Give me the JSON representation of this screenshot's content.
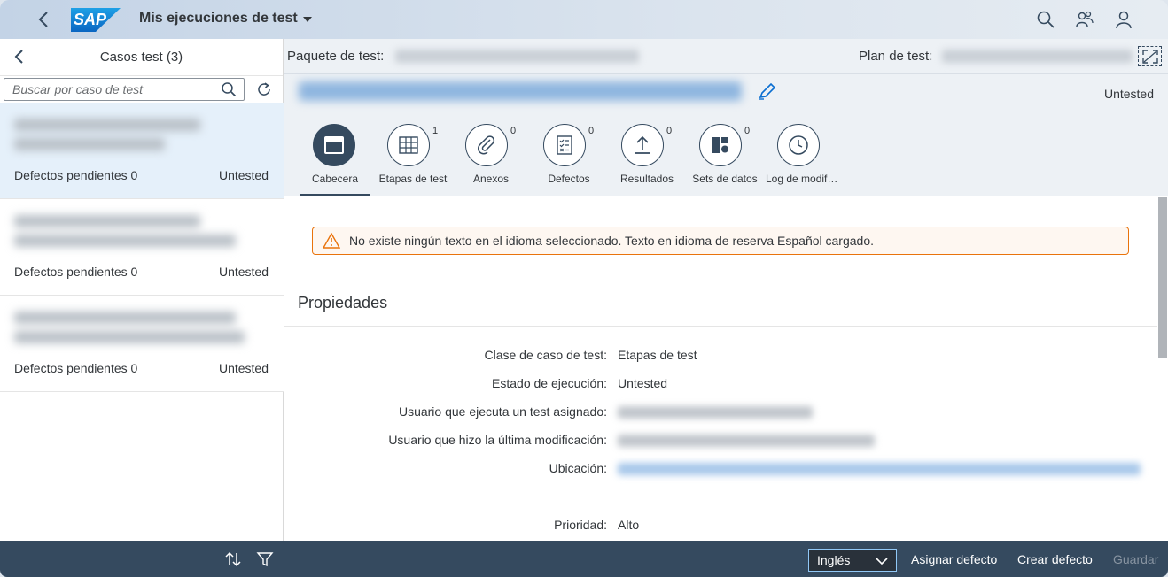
{
  "shell": {
    "logo_text": "SAP",
    "title": "Mis ejecuciones de test",
    "icons": [
      "back-icon",
      "search-icon",
      "people-icon",
      "user-icon"
    ]
  },
  "master": {
    "title": "Casos test (3)",
    "search_placeholder": "Buscar por caso de test",
    "items": [
      {
        "defects": "Defectos pendientes 0",
        "status": "Untested"
      },
      {
        "defects": "Defectos pendientes 0",
        "status": "Untested"
      },
      {
        "defects": "Defectos pendientes 0",
        "status": "Untested"
      }
    ],
    "footer_icons": [
      "sort-icon",
      "filter-icon"
    ]
  },
  "detail": {
    "package_label": "Paquete de test:",
    "plan_label": "Plan de test:",
    "status": "Untested",
    "tabs": [
      {
        "label": "Cabecera",
        "count": "",
        "icon": "header-icon"
      },
      {
        "label": "Etapas de test",
        "count": "1",
        "icon": "table-icon"
      },
      {
        "label": "Anexos",
        "count": "0",
        "icon": "attachment-icon"
      },
      {
        "label": "Defectos",
        "count": "0",
        "icon": "checklist-icon"
      },
      {
        "label": "Resultados",
        "count": "0",
        "icon": "upload-icon"
      },
      {
        "label": "Sets de datos",
        "count": "0",
        "icon": "dataset-icon"
      },
      {
        "label": "Log de modificaciones",
        "count": "",
        "icon": "clock-icon"
      }
    ],
    "warning": "No existe ningún texto en el idioma seleccionado. Texto en idioma de reserva Español cargado.",
    "section_title": "Propiedades",
    "properties": {
      "clase_label": "Clase de caso de test:",
      "clase_value": "Etapas de test",
      "estado_label": "Estado de ejecución:",
      "estado_value": "Untested",
      "usuario_label": "Usuario que ejecuta un test asignado:",
      "modif_label": "Usuario que hizo la última modificación:",
      "ubicacion_label": "Ubicación:",
      "prioridad_label": "Prioridad:",
      "prioridad_value": "Alto"
    }
  },
  "footer": {
    "language": "Inglés",
    "assign_defect": "Asignar defecto",
    "create_defect": "Crear defecto",
    "save": "Guardar"
  },
  "colors": {
    "shell_dark": "#354a5f",
    "accent_blue": "#0a6ed1",
    "warning": "#e9730c",
    "selected_row": "#e5f0fa"
  }
}
